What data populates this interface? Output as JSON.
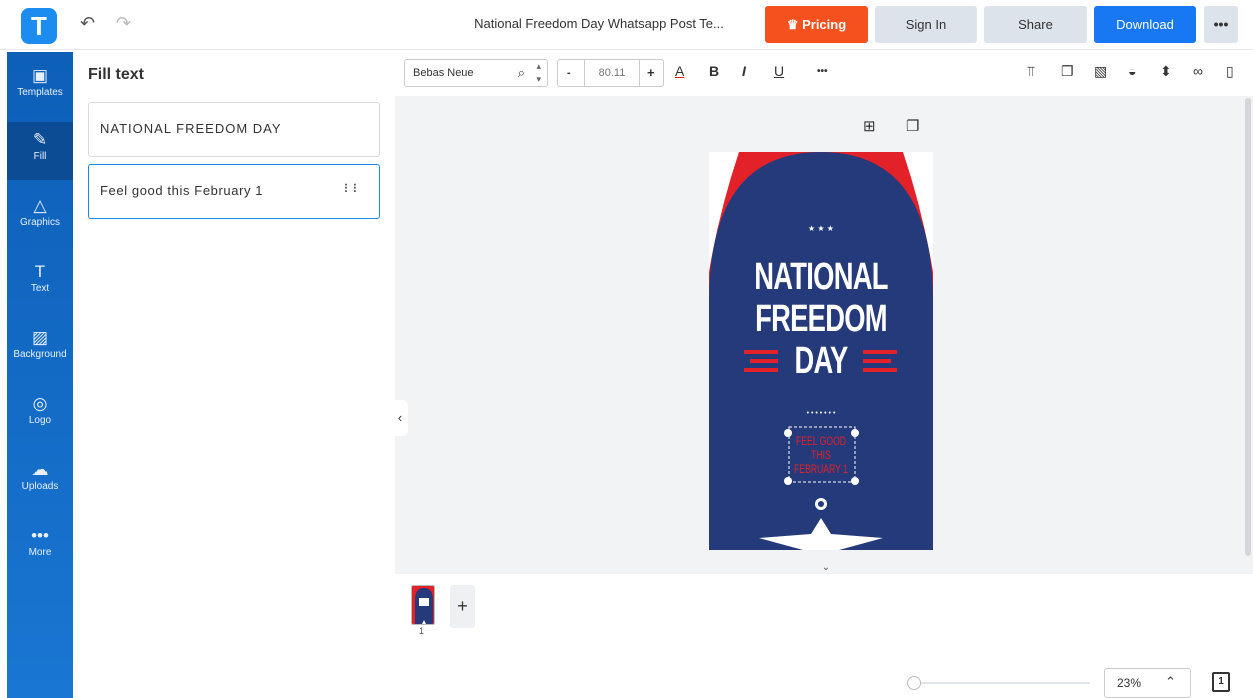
{
  "app": {
    "logo_letter": "T"
  },
  "header": {
    "undo_icon": "undo-icon",
    "redo_icon": "redo-icon",
    "doc_title": "National Freedom Day Whatsapp Post Te...",
    "pricing_label": "Pricing",
    "signin_label": "Sign In",
    "share_label": "Share",
    "download_label": "Download",
    "more_label": "•••",
    "pricing_color": "#f4511e",
    "download_color": "#1877f2"
  },
  "sidebar": {
    "items": [
      {
        "label": "Templates",
        "icon": "templates-icon",
        "glyph": "▣"
      },
      {
        "label": "Fill",
        "icon": "pencil-icon",
        "glyph": "✎"
      },
      {
        "label": "Graphics",
        "icon": "shapes-icon",
        "glyph": "△"
      },
      {
        "label": "Text",
        "icon": "text-icon",
        "glyph": "T"
      },
      {
        "label": "Background",
        "icon": "background-icon",
        "glyph": "▨"
      },
      {
        "label": "Logo",
        "icon": "logo-icon",
        "glyph": "◎"
      },
      {
        "label": "Uploads",
        "icon": "cloud-upload-icon",
        "glyph": "☁"
      },
      {
        "label": "More",
        "icon": "more-icon",
        "glyph": "•••"
      }
    ],
    "active": "Fill"
  },
  "fill_panel": {
    "title": "Fill text",
    "fields": [
      {
        "value": "NATIONAL FREEDOM DAY"
      },
      {
        "value": "Feel good this February 1"
      }
    ]
  },
  "toolbar": {
    "font_name": "Bebas Neue",
    "size_minus": "-",
    "font_size": "80.11",
    "size_plus": "+",
    "color_label": "A",
    "bold_label": "B",
    "italic_label": "I",
    "underline_label": "U",
    "more_label": "•••"
  },
  "poster": {
    "stars": "★ ★ ★",
    "line1": "NATIONAL",
    "line2": "FREEDOM",
    "line3": "DAY",
    "dots": "• • • • • • •",
    "tagline1": "FEEL GOOD",
    "tagline2": "THIS",
    "tagline3": "FEBRUARY 1",
    "navy": "#253a7a",
    "red": "#e32129"
  },
  "pages": {
    "current": "1",
    "add_label": "+"
  },
  "zoom": {
    "value": "23%",
    "chevron": "⌃",
    "level": 0.02
  },
  "pages_count_label": "1"
}
